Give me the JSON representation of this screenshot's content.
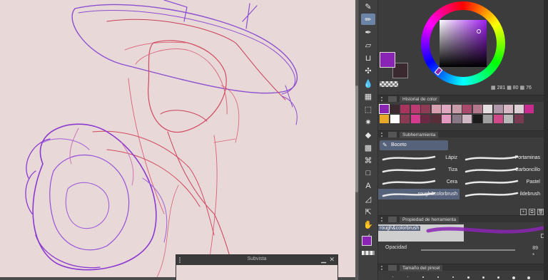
{
  "subview": {
    "title": "Subvista",
    "minimize": "▁",
    "close": "✕"
  },
  "color": {
    "main": "#8a24b4",
    "sub": "#3a2a30",
    "readout": "281 80 76",
    "readout_h": "281",
    "readout_s": "80",
    "readout_v": "76"
  },
  "history": {
    "title": "Historial de color",
    "row1": [
      "#8a24b4",
      "#3a2a30",
      "#a8345e",
      "#be3a72",
      "#8e3c55",
      "#d6a0b0",
      "#e0a8c0",
      "#c89ca8",
      "#a84a6c",
      "#b4788c",
      "#e6dfe2",
      "#b098a8",
      "#d8b8c4",
      "#dcd0d4",
      "#c82a8e"
    ],
    "row2": [
      "#e8a82a",
      "#ffffff",
      "#8a3a52",
      "#d63a8e",
      "#6a2a44",
      "#5a2e38",
      "#e49ac0",
      "#8a7886",
      "#d0b8c4",
      "#1a1a1a",
      "#a0a0a0",
      "#d04a8a",
      "#b8b8b8",
      "#7a3a52",
      "#3c3c3c"
    ]
  },
  "subtool": {
    "header": "Subherramienta",
    "group": "Boceto",
    "brushes": [
      {
        "label": "Lápiz",
        "side": "left"
      },
      {
        "label": "Portaminas",
        "side": "right"
      },
      {
        "label": "Tiza",
        "side": "left"
      },
      {
        "label": "Carboncillo",
        "side": "right"
      },
      {
        "label": "Cera",
        "side": "left"
      },
      {
        "label": "Pastel",
        "side": "right"
      },
      {
        "label": "rough&colorbrush",
        "side": "left"
      },
      {
        "label": "ildebrush",
        "side": "right"
      }
    ]
  },
  "tool_property": {
    "header": "Propiedad de herramienta",
    "brush_name": "rough&colorbrush",
    "opacity_label": "Opacidad",
    "opacity_value": "89"
  },
  "brush_size": {
    "header": "Tamaño del pincel"
  },
  "tools": [
    "pen-tip-icon",
    "pencil-icon",
    "fountain-pen-icon",
    "eraser-icon",
    "fill-bucket-icon",
    "airbrush-icon",
    "blend-drop-icon",
    "grid-icon",
    "dashed-select-icon",
    "magic-wand-icon",
    "fill-icon",
    "gradient-icon",
    "lasso-icon",
    "rectangle-icon",
    "text-icon",
    "ruler-icon",
    "move-layer-icon",
    "hand-icon",
    "eyedropper-icon"
  ]
}
